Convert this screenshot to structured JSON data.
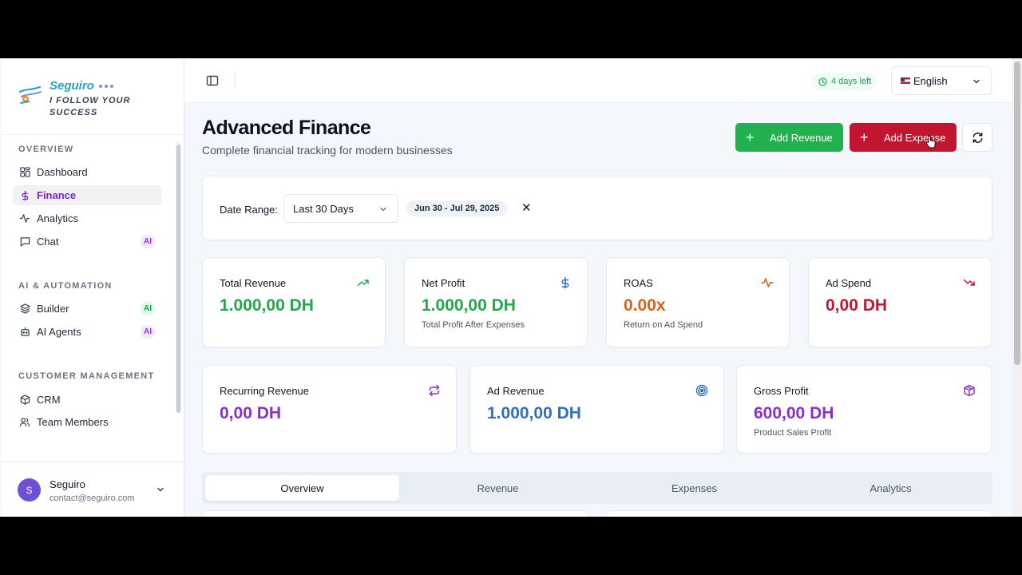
{
  "brand": {
    "name": "Seguiro",
    "tagline": "I FOLLOW YOUR SUCCESS"
  },
  "sidebar": {
    "sections": [
      {
        "title": "OVERVIEW"
      },
      {
        "title": "AI & AUTOMATION"
      },
      {
        "title": "CUSTOMER MANAGEMENT"
      }
    ],
    "items": [
      {
        "label": "Dashboard",
        "icon": "grid-icon"
      },
      {
        "label": "Finance",
        "icon": "dollar-icon",
        "active": true
      },
      {
        "label": "Analytics",
        "icon": "activity-icon"
      },
      {
        "label": "Chat",
        "icon": "chat-icon",
        "badge": "AI"
      },
      {
        "label": "Builder",
        "icon": "layers-icon",
        "badge": "AI"
      },
      {
        "label": "AI Agents",
        "icon": "bot-icon",
        "badge": "AI"
      },
      {
        "label": "CRM",
        "icon": "package-icon"
      },
      {
        "label": "Team Members",
        "icon": "users-icon"
      }
    ]
  },
  "user": {
    "initial": "S",
    "name": "Seguiro",
    "email": "contact@seguiro.com"
  },
  "topbar": {
    "trial": "4 days left",
    "language": "English"
  },
  "header": {
    "title": "Advanced Finance",
    "subtitle": "Complete financial tracking for modern businesses",
    "add_revenue": "Add Revenue",
    "add_expense": "Add Expense"
  },
  "filter": {
    "label": "Date Range:",
    "selected": "Last 30 Days",
    "range": "Jun 30 - Jul 29, 2025"
  },
  "stats_row1": [
    {
      "title": "Total Revenue",
      "value": "1.000,00 DH",
      "sub": "",
      "color": "#22a74a",
      "icon": "trending-up-icon"
    },
    {
      "title": "Net Profit",
      "value": "1.000,00 DH",
      "sub": "Total Profit After Expenses",
      "color": "#22a74a",
      "icon": "dollar-icon"
    },
    {
      "title": "ROAS",
      "value": "0.00x",
      "sub": "Return on Ad Spend",
      "color": "#d9601c",
      "icon": "activity-icon"
    },
    {
      "title": "Ad Spend",
      "value": "0,00 DH",
      "sub": "",
      "color": "#c0162f",
      "icon": "trending-down-icon"
    }
  ],
  "stats_row2": [
    {
      "title": "Recurring Revenue",
      "value": "0,00 DH",
      "sub": "",
      "color": "#8b2fc9",
      "icon": "repeat-icon"
    },
    {
      "title": "Ad Revenue",
      "value": "1.000,00 DH",
      "sub": "",
      "color": "#2f6fc0",
      "icon": "target-icon"
    },
    {
      "title": "Gross Profit",
      "value": "600,00 DH",
      "sub": "Product Sales Profit",
      "color": "#8b2fc9",
      "icon": "box-icon"
    }
  ],
  "tabs": [
    {
      "label": "Overview",
      "active": true
    },
    {
      "label": "Revenue"
    },
    {
      "label": "Expenses"
    },
    {
      "label": "Analytics"
    }
  ]
}
